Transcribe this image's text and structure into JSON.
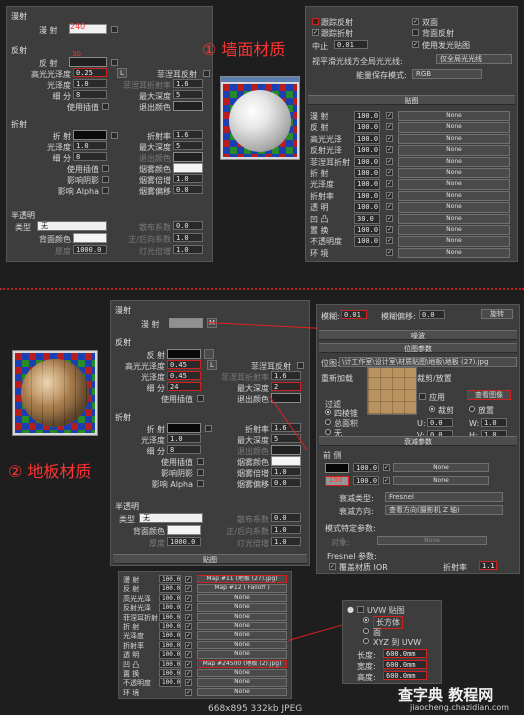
{
  "annotations": {
    "wall_title": "① 墙面材质",
    "floor_title": "② 地板材质",
    "wall_diffuse_value": "240",
    "wall_reflect_value": "30"
  },
  "wall_mtl": {
    "diffuse_group": "漫射",
    "diffuse_label": "漫 射",
    "reflection_group": "反射",
    "reflect_label": "反 射",
    "hilight_gloss_label": "高光光泽度",
    "hilight_gloss_value": "0.25",
    "lock_label": "L",
    "fresnel_label": "菲涅耳反射",
    "refl_gloss_label": "光泽度",
    "refl_gloss_value": "1.0",
    "fresnel_ior_label": "菲涅耳折射率",
    "fresnel_ior_value": "1.6",
    "subdivs_label": "细 分",
    "subdivs_value": "8",
    "max_depth_label": "最大深度",
    "max_depth_value": "5",
    "use_interp_label": "使用插值",
    "exit_color_label": "退出颜色",
    "refraction_group": "折射",
    "refract_label": "折 射",
    "ior_label": "折射率",
    "ior_value": "1.6",
    "refr_gloss_label": "光泽度",
    "refr_gloss_value": "1.0",
    "refr_max_depth_label": "最大深度",
    "refr_max_depth_value": "5",
    "refr_subdivs_label": "细 分",
    "refr_subdivs_value": "8",
    "refr_exit_color_label": "退出颜色",
    "refr_use_interp_label": "使用插值",
    "fog_color_label": "烟雾颜色",
    "affect_shadows_label": "影响阴影",
    "fog_mult_label": "烟雾倍增",
    "fog_mult_value": "1.0",
    "affect_alpha_label": "影响 Alpha",
    "fog_bias_label": "烟雾偏移",
    "fog_bias_value": "0.0",
    "translucency_group": "半透明",
    "type_label": "类型",
    "type_value": "无",
    "back_color_label": "背面颜色",
    "thickness_label": "厚度",
    "thickness_value": "1000.0",
    "scatter_label": "散布系数",
    "scatter_value": "0.0",
    "fwd_back_label": "正/后向系数",
    "fwd_back_value": "1.0",
    "light_mult_label": "灯光倍增",
    "light_mult_value": "1.0"
  },
  "wall_options": {
    "trace_reflections": "跟踪反射",
    "double_sided": "双面",
    "trace_refractions": "跟踪折射",
    "reflect_on_back": "背面反射",
    "cutoff_label": "中止",
    "cutoff_value": "0.01",
    "use_irradiance": "使用发光贴图",
    "glossy_label": "视平滑光线方全局光光线:",
    "glossy_value": "仅全局光光线",
    "energy_label": "能量保存模式:",
    "energy_value": "RGB",
    "maps_header": "贴图",
    "maps": [
      {
        "name": "漫 射",
        "value": "100.0",
        "map": "None"
      },
      {
        "name": "反 射",
        "value": "100.0",
        "map": "None"
      },
      {
        "name": "高光光泽",
        "value": "100.0",
        "map": "None"
      },
      {
        "name": "反射光泽",
        "value": "100.0",
        "map": "None"
      },
      {
        "name": "菲涅耳折射",
        "value": "100.0",
        "map": "None"
      },
      {
        "name": "折 射",
        "value": "100.0",
        "map": "None"
      },
      {
        "name": "光泽度",
        "value": "100.0",
        "map": "None"
      },
      {
        "name": "折射率",
        "value": "100.0",
        "map": "None"
      },
      {
        "name": "透 明",
        "value": "100.0",
        "map": "None"
      },
      {
        "name": "凹 凸",
        "value": "30.0",
        "map": "None"
      },
      {
        "name": "置 换",
        "value": "100.0",
        "map": "None"
      },
      {
        "name": "不透明度",
        "value": "100.0",
        "map": "None"
      },
      {
        "name": "环 境",
        "value": "",
        "map": "None"
      }
    ]
  },
  "floor_mtl": {
    "diffuse_group": "漫射",
    "diffuse_label": "漫 射",
    "diffuse_map_btn": "M",
    "reflection_group": "反射",
    "reflect_label": "反 射",
    "hilight_gloss_label": "高光光泽度",
    "hilight_gloss_value": "0.45",
    "lock_label": "L",
    "fresnel_label": "菲涅耳反射",
    "refl_gloss_label": "光泽度",
    "refl_gloss_value": "0.45",
    "fresnel_ior_label": "菲涅耳折射率",
    "fresnel_ior_value": "1.6",
    "subdivs_label": "细 分",
    "subdivs_value": "24",
    "max_depth_label": "最大深度",
    "max_depth_value": "2",
    "use_interp_label": "使用插值",
    "exit_color_label": "退出颜色",
    "refraction_group": "折射",
    "refract_label": "折 射",
    "ior_label": "折射率",
    "ior_value": "1.6",
    "refr_gloss_label": "光泽度",
    "refr_gloss_value": "1.0",
    "refr_max_depth_label": "最大深度",
    "refr_max_depth_value": "5",
    "refr_subdivs_label": "细 分",
    "refr_subdivs_value": "8",
    "refr_exit_color_label": "退出颜色",
    "refr_use_interp_label": "使用插值",
    "fog_color_label": "烟雾颜色",
    "affect_shadows_label": "影响阴影",
    "fog_mult_label": "烟雾倍增",
    "fog_mult_value": "1.0",
    "affect_alpha_label": "影响 Alpha",
    "fog_bias_label": "烟雾偏移",
    "fog_bias_value": "0.0",
    "translucency_group": "半透明",
    "type_label": "类型",
    "type_value": "无",
    "back_color_label": "背面颜色",
    "thickness_label": "厚度",
    "thickness_value": "1000.0",
    "scatter_label": "散布系数",
    "scatter_value": "0.0",
    "fwd_back_label": "正/后向系数",
    "fwd_back_value": "1.0",
    "light_mult_label": "灯光倍增",
    "light_mult_value": "1.0",
    "maps_header": "贴图",
    "maps": [
      {
        "name": "漫 射",
        "value": "100.0",
        "map": "Map #11 (地板 (27).jpg)",
        "hl": true
      },
      {
        "name": "反 射",
        "value": "100.0",
        "map": "Map #12 ( Falloff )",
        "hl": false
      },
      {
        "name": "高光光泽",
        "value": "100.0",
        "map": "None",
        "hl": false
      },
      {
        "name": "反射光泽",
        "value": "100.0",
        "map": "None",
        "hl": false
      },
      {
        "name": "菲涅耳折射",
        "value": "100.0",
        "map": "None",
        "hl": false
      },
      {
        "name": "折 射",
        "value": "100.0",
        "map": "None",
        "hl": false
      },
      {
        "name": "光泽度",
        "value": "100.0",
        "map": "None",
        "hl": false
      },
      {
        "name": "折射率",
        "value": "100.0",
        "map": "None",
        "hl": false
      },
      {
        "name": "透 明",
        "value": "100.0",
        "map": "None",
        "hl": false
      },
      {
        "name": "凹 凸",
        "value": "100.0",
        "map": "Map #24500 (地板 (2).jpg)",
        "hl": true
      },
      {
        "name": "置 换",
        "value": "100.0",
        "map": "None",
        "hl": false
      },
      {
        "name": "不透明度",
        "value": "100.0",
        "map": "None",
        "hl": false
      },
      {
        "name": "环 境",
        "value": "",
        "map": "None",
        "hl": false
      }
    ]
  },
  "bitmap_panel": {
    "blur_label": "模糊:",
    "blur_value": "0.01",
    "blur_offset_label": "模糊偏移:",
    "blur_offset_value": "0.0",
    "rotate_btn": "旋转",
    "noise_header": "噪波",
    "bitmap_params_header": "位图参数",
    "bitmap_label": "位图:",
    "bitmap_path": "\\计工作室\\设计室\\材质贴图\\地板\\地板 (27).jpg",
    "reload_btn": "重新加载",
    "crop_label": "裁剪/放置",
    "apply_label": "应用",
    "view_image_btn": "查看图像",
    "filter_label": "过滤",
    "filter_opt1": "四棱锥",
    "filter_opt2": "总面积",
    "filter_opt3": "无",
    "crop_opt": "裁剪",
    "place_opt": "放置",
    "u_label": "U:",
    "u_value": "0.0",
    "w_label": "W:",
    "w_value": "1.0",
    "v_label": "V:",
    "v_value": "0.0",
    "h_label": "H:",
    "h_value": "1.0"
  },
  "falloff_panel": {
    "header": "衰减参数",
    "front_side": "前 侧",
    "row1_value": "100.0",
    "row1_map": "None",
    "row2_color": "150",
    "row2_value": "100.0",
    "row2_map": "None",
    "falloff_type_label": "衰减类型:",
    "falloff_type_value": "Fresnel",
    "falloff_dir_label": "衰减方向:",
    "falloff_dir_value": "查看方向(摄影机 Z 轴)",
    "mode_header": "模式特定参数:",
    "object_label": "对象:",
    "object_value": "None",
    "fresnel_params": "Fresnel 参数:",
    "override_ior": "覆盖材质 IOR",
    "ior_label": "折射率",
    "ior_value": "1.1"
  },
  "uvw_panel": {
    "title": "UVW 贴图",
    "opt_box": "长方体",
    "opt_face": "面",
    "opt_xyz": "XYZ 到 UVW",
    "length_label": "长度:",
    "length_value": "600.0mm",
    "width_label": "宽度:",
    "width_value": "600.0mm",
    "height_label": "高度:",
    "height_value": "600.0mm"
  },
  "footer": {
    "info": "668x895  332kb  JPEG",
    "watermark_main": "查字典 教程网",
    "watermark_url": "jiaocheng.chazidian.com"
  },
  "colors": {
    "accent_red": "#d02020",
    "panel_bg": "#3d3d3d"
  }
}
